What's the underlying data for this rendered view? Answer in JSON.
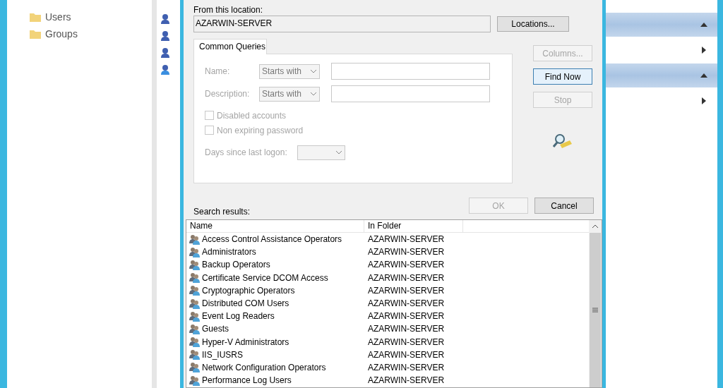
{
  "tree": {
    "items": [
      {
        "label": "Users"
      },
      {
        "label": "Groups"
      }
    ]
  },
  "dialog": {
    "location_label": "From this location:",
    "location": "AZARWIN-SERVER",
    "locations_button": "Locations...",
    "tab": "Common Queries",
    "query_fields": [
      {
        "label": "Name:",
        "match": "Starts with",
        "disabled": true
      },
      {
        "label": "Description:",
        "match": "Starts with",
        "disabled": true
      }
    ],
    "checkboxes": [
      {
        "label": "Disabled accounts",
        "checked": false,
        "disabled": true
      },
      {
        "label": "Non expiring password",
        "checked": false,
        "disabled": true
      }
    ],
    "days": {
      "label": "Days since last logon:",
      "disabled": true
    },
    "side_buttons": [
      {
        "label": "Columns...",
        "disabled": true,
        "default": false
      },
      {
        "label": "Find Now",
        "disabled": false,
        "default": true
      },
      {
        "label": "Stop",
        "disabled": true,
        "default": false
      }
    ],
    "ok": {
      "label": "OK",
      "disabled": true
    },
    "cancel": {
      "label": "Cancel",
      "disabled": false
    },
    "results_label": "Search results:",
    "columns": [
      "Name",
      "In Folder"
    ],
    "rows": [
      {
        "name": "Access Control Assistance Operators",
        "folder": "AZARWIN-SERVER"
      },
      {
        "name": "Administrators",
        "folder": "AZARWIN-SERVER"
      },
      {
        "name": "Backup Operators",
        "folder": "AZARWIN-SERVER"
      },
      {
        "name": "Certificate Service DCOM Access",
        "folder": "AZARWIN-SERVER"
      },
      {
        "name": "Cryptographic Operators",
        "folder": "AZARWIN-SERVER"
      },
      {
        "name": "Distributed COM Users",
        "folder": "AZARWIN-SERVER"
      },
      {
        "name": "Event Log Readers",
        "folder": "AZARWIN-SERVER"
      },
      {
        "name": "Guests",
        "folder": "AZARWIN-SERVER"
      },
      {
        "name": "Hyper-V Administrators",
        "folder": "AZARWIN-SERVER"
      },
      {
        "name": "IIS_IUSRS",
        "folder": "AZARWIN-SERVER"
      },
      {
        "name": "Network Configuration Operators",
        "folder": "AZARWIN-SERVER"
      },
      {
        "name": "Performance Log Users",
        "folder": "AZARWIN-SERVER"
      }
    ]
  }
}
